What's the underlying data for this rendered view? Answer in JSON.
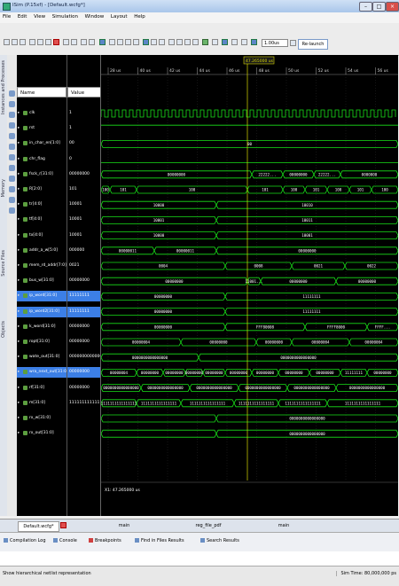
{
  "window": {
    "title": "ISim (P.15xf) - [Default.wcfg*]"
  },
  "menu": [
    "File",
    "Edit",
    "View",
    "Simulation",
    "Window",
    "Layout",
    "Help"
  ],
  "toolbar": {
    "run_time": "1.00us",
    "relaunch_label": "Re-launch"
  },
  "side_panel": {
    "labels": [
      "Instances and Processes",
      "Memory",
      "Source Files",
      "Objects"
    ]
  },
  "wave_panel": {
    "name_header": "Name",
    "value_header": "Value",
    "cursor_time": "47.265000 us",
    "status_time": "X1: 47.265000 us",
    "time_ticks": [
      "28 us",
      "40 us",
      "42 us",
      "44 us",
      "46 us",
      "48 us",
      "50 us",
      "52 us",
      "54 us",
      "56 us"
    ],
    "signals": [
      {
        "name": "clk",
        "value": "1",
        "selected": false
      },
      {
        "name": "rst",
        "value": "1",
        "selected": false
      },
      {
        "name": "in_char_en[1:0]",
        "value": "00",
        "selected": false
      },
      {
        "name": "chr_flag",
        "value": "0",
        "selected": false
      },
      {
        "name": "fsck_r[31:0]",
        "value": "00000000",
        "selected": false
      },
      {
        "name": "R[2:0]",
        "value": "101",
        "selected": false
      },
      {
        "name": "tr[4:0]",
        "value": "10001",
        "selected": false
      },
      {
        "name": "tf[4:0]",
        "value": "10001",
        "selected": false
      },
      {
        "name": "tx[4:0]",
        "value": "10001",
        "selected": false
      },
      {
        "name": "addr_a_w[5:0]",
        "value": "000000",
        "selected": false
      },
      {
        "name": "mem_rd_addr[7:0]",
        "value": "0021",
        "selected": false
      },
      {
        "name": "bus_w[31:0]",
        "value": "00000000",
        "selected": false
      },
      {
        "name": "ip_word[31:0]",
        "value": "11111111",
        "selected": true
      },
      {
        "name": "ip_word2[31:0]",
        "value": "11111111",
        "selected": true
      },
      {
        "name": "k_word[31:0]",
        "value": "00000000",
        "selected": false
      },
      {
        "name": "ropt[31:0]",
        "value": "00000000",
        "selected": false
      },
      {
        "name": "wate_out[31:0]",
        "value": "00000000000000000",
        "selected": false
      },
      {
        "name": "wra_next_out[31:0]",
        "value": "00000000",
        "selected": true
      },
      {
        "name": "rf[31:0]",
        "value": "00000000",
        "selected": false
      },
      {
        "name": "m[31:0]",
        "value": "1111111111111111",
        "selected": false
      },
      {
        "name": "rx_w[31:0]",
        "value": "",
        "selected": false
      },
      {
        "name": "rx_out[31:0]",
        "value": "",
        "selected": false
      }
    ],
    "waves": [
      {
        "kind": "clock"
      },
      {
        "kind": "high"
      },
      {
        "kind": "bus",
        "segments": [
          {
            "start": 0,
            "end": 335,
            "label": "00"
          }
        ]
      },
      {
        "kind": "low"
      },
      {
        "kind": "bus",
        "segments": [
          {
            "start": 0,
            "end": 170,
            "label": "00000000"
          },
          {
            "start": 170,
            "end": 205,
            "label": "22222..."
          },
          {
            "start": 205,
            "end": 240,
            "label": "00000000"
          },
          {
            "start": 240,
            "end": 270,
            "label": "22222..."
          },
          {
            "start": 270,
            "end": 335,
            "label": "0000000"
          }
        ]
      },
      {
        "kind": "bus",
        "segments": [
          {
            "start": 0,
            "end": 10,
            "label": "100"
          },
          {
            "start": 10,
            "end": 40,
            "label": "101"
          },
          {
            "start": 40,
            "end": 165,
            "label": "100"
          },
          {
            "start": 165,
            "end": 205,
            "label": "101"
          },
          {
            "start": 205,
            "end": 230,
            "label": "100"
          },
          {
            "start": 230,
            "end": 255,
            "label": "101"
          },
          {
            "start": 255,
            "end": 280,
            "label": "100"
          },
          {
            "start": 280,
            "end": 305,
            "label": "101"
          },
          {
            "start": 305,
            "end": 335,
            "label": "100"
          }
        ]
      },
      {
        "kind": "bus",
        "segments": [
          {
            "start": 0,
            "end": 130,
            "label": "10000"
          },
          {
            "start": 130,
            "end": 335,
            "label": "10010"
          }
        ]
      },
      {
        "kind": "bus",
        "segments": [
          {
            "start": 0,
            "end": 130,
            "label": "10001"
          },
          {
            "start": 130,
            "end": 335,
            "label": "10011"
          }
        ]
      },
      {
        "kind": "bus",
        "segments": [
          {
            "start": 0,
            "end": 130,
            "label": "10000"
          },
          {
            "start": 130,
            "end": 335,
            "label": "10001"
          }
        ]
      },
      {
        "kind": "bus",
        "segments": [
          {
            "start": 0,
            "end": 60,
            "label": "00000011"
          },
          {
            "start": 60,
            "end": 130,
            "label": "00000011"
          },
          {
            "start": 130,
            "end": 335,
            "label": "00000000"
          }
        ]
      },
      {
        "kind": "bus",
        "segments": [
          {
            "start": 0,
            "end": 140,
            "label": "0004"
          },
          {
            "start": 140,
            "end": 215,
            "label": "0008"
          },
          {
            "start": 215,
            "end": 275,
            "label": "0021"
          },
          {
            "start": 275,
            "end": 335,
            "label": "0022"
          }
        ]
      },
      {
        "kind": "bus",
        "segments": [
          {
            "start": 0,
            "end": 165,
            "label": "00000000"
          },
          {
            "start": 165,
            "end": 180,
            "label": "11001..."
          },
          {
            "start": 180,
            "end": 265,
            "label": "00000000"
          },
          {
            "start": 265,
            "end": 335,
            "label": "00000000"
          }
        ]
      },
      {
        "kind": "bus",
        "segments": [
          {
            "start": 0,
            "end": 140,
            "label": "00000000"
          },
          {
            "start": 140,
            "end": 335,
            "label": "11111111"
          }
        ]
      },
      {
        "kind": "bus",
        "segments": [
          {
            "start": 0,
            "end": 140,
            "label": "00000000"
          },
          {
            "start": 140,
            "end": 335,
            "label": "11111111"
          }
        ]
      },
      {
        "kind": "bus",
        "segments": [
          {
            "start": 0,
            "end": 140,
            "label": "00000000"
          },
          {
            "start": 140,
            "end": 230,
            "label": "FFF80008"
          },
          {
            "start": 230,
            "end": 300,
            "label": "FFFF8000"
          },
          {
            "start": 300,
            "end": 335,
            "label": "FFFF..."
          }
        ]
      },
      {
        "kind": "bus",
        "segments": [
          {
            "start": 0,
            "end": 90,
            "label": "00000004"
          },
          {
            "start": 90,
            "end": 175,
            "label": "00000000"
          },
          {
            "start": 175,
            "end": 215,
            "label": "00000000"
          },
          {
            "start": 215,
            "end": 280,
            "label": "00000004"
          },
          {
            "start": 280,
            "end": 335,
            "label": "00000004"
          }
        ]
      },
      {
        "kind": "bus",
        "segments": [
          {
            "start": 0,
            "end": 110,
            "label": "0000000000000000"
          },
          {
            "start": 110,
            "end": 335,
            "label": "0000000000000000"
          }
        ]
      },
      {
        "kind": "bus",
        "segments": [
          {
            "start": 0,
            "end": 40,
            "label": "00000004"
          },
          {
            "start": 40,
            "end": 70,
            "label": "00000000"
          },
          {
            "start": 70,
            "end": 95,
            "label": "00000000"
          },
          {
            "start": 95,
            "end": 115,
            "label": "00000000"
          },
          {
            "start": 115,
            "end": 140,
            "label": "00000000"
          },
          {
            "start": 140,
            "end": 170,
            "label": "00000000"
          },
          {
            "start": 170,
            "end": 200,
            "label": "00000000"
          },
          {
            "start": 200,
            "end": 235,
            "label": "00000000"
          },
          {
            "start": 235,
            "end": 270,
            "label": "00000000"
          },
          {
            "start": 270,
            "end": 300,
            "label": "11111111"
          },
          {
            "start": 300,
            "end": 335,
            "label": "00000000"
          }
        ]
      },
      {
        "kind": "bus",
        "segments": [
          {
            "start": 0,
            "end": 45,
            "label": "0000000000000000"
          },
          {
            "start": 45,
            "end": 100,
            "label": "0000000000000000"
          },
          {
            "start": 100,
            "end": 155,
            "label": "0000000000000000"
          },
          {
            "start": 155,
            "end": 210,
            "label": "0000000000000000"
          },
          {
            "start": 210,
            "end": 265,
            "label": "0000000000000000"
          },
          {
            "start": 265,
            "end": 335,
            "label": "0000000000000000"
          }
        ]
      },
      {
        "kind": "bus",
        "segments": [
          {
            "start": 0,
            "end": 40,
            "label": "1111111111111111"
          },
          {
            "start": 40,
            "end": 90,
            "label": "1111111111111111"
          },
          {
            "start": 90,
            "end": 150,
            "label": "1111111111111111"
          },
          {
            "start": 150,
            "end": 200,
            "label": "1111111111111111"
          },
          {
            "start": 200,
            "end": 255,
            "label": "1111111111111111"
          },
          {
            "start": 255,
            "end": 335,
            "label": "1111111111111111"
          }
        ]
      },
      {
        "kind": "bus",
        "segments": [
          {
            "start": 0,
            "end": 130,
            "label": ""
          },
          {
            "start": 130,
            "end": 335,
            "label": "0000000000000000"
          }
        ]
      },
      {
        "kind": "bus",
        "segments": [
          {
            "start": 0,
            "end": 130,
            "label": ""
          },
          {
            "start": 130,
            "end": 335,
            "label": "0000000000000000"
          }
        ]
      }
    ]
  },
  "bottom_tabs": [
    "Default.wcfg*",
    "main",
    "reg_file_pdf",
    "main"
  ],
  "console_tabs": [
    "Compilation Log",
    "Console",
    "Breakpoints",
    "Find in Files Results",
    "Search Results"
  ],
  "status": {
    "left": "Show hierarchical netlist representation",
    "right": "Sim Time: 80,000,000 ps"
  },
  "colors": {
    "wave": "#19e019",
    "selected": "#3c7fe6",
    "background": "#000000",
    "cursor": "#d8d800"
  }
}
